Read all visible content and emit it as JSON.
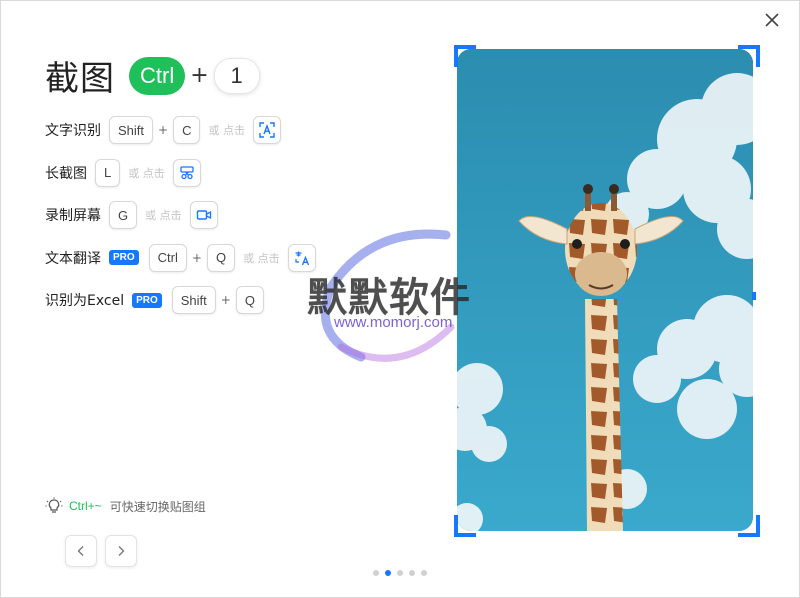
{
  "header": {
    "title": "截图",
    "key_main": "Ctrl",
    "plus": "+",
    "key_second": "1"
  },
  "shortcuts": [
    {
      "label": "文字识别",
      "keys": [
        "Shift",
        "C"
      ],
      "or_click": "或 点击",
      "icon": "ocr-icon"
    },
    {
      "label": "长截图",
      "keys": [
        "L"
      ],
      "or_click": "或 点击",
      "icon": "scroll-capture-icon"
    },
    {
      "label": "录制屏幕",
      "keys": [
        "G"
      ],
      "or_click": "或 点击",
      "icon": "video-record-icon"
    },
    {
      "label": "文本翻译",
      "pro": "PRO",
      "keys": [
        "Ctrl",
        "Q"
      ],
      "or_click": "或 点击",
      "icon": "translate-icon"
    },
    {
      "label": "识别为Excel",
      "pro": "PRO",
      "keys": [
        "Shift",
        "Q"
      ]
    }
  ],
  "plus_symbol": "+",
  "tip": {
    "key": "Ctrl+~",
    "text": "可快速切换贴图组"
  },
  "pagination": {
    "total": 5,
    "active_index": 1
  },
  "watermark": {
    "title": "默默软件",
    "url": "www.momorj.com"
  },
  "colors": {
    "accent": "#1677ff",
    "green": "#1fbf5a"
  }
}
